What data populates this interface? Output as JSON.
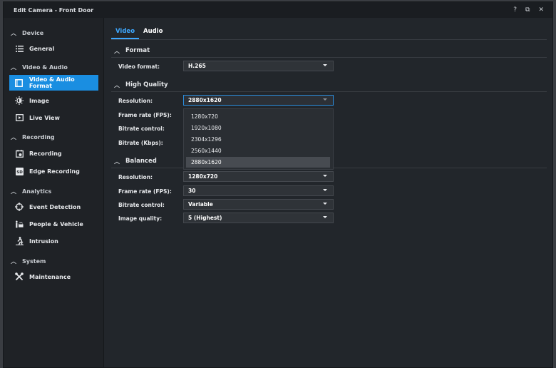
{
  "window": {
    "title": "Edit Camera - Front Door",
    "help": "?",
    "restore": "⧉",
    "close": "✕"
  },
  "sidebar": {
    "sections": [
      {
        "label": "Device"
      },
      {
        "label": "Video & Audio"
      },
      {
        "label": "Recording"
      },
      {
        "label": "Analytics"
      },
      {
        "label": "System"
      }
    ],
    "items": [
      {
        "label": "General",
        "icon": "list-icon"
      },
      {
        "label": "Video & Audio Format",
        "icon": "video-format-icon"
      },
      {
        "label": "Image",
        "icon": "brightness-icon"
      },
      {
        "label": "Live View",
        "icon": "live-view-icon"
      },
      {
        "label": "Recording",
        "icon": "recording-icon"
      },
      {
        "label": "Edge Recording",
        "icon": "sd-card-icon"
      },
      {
        "label": "Event Detection",
        "icon": "crosshair-icon"
      },
      {
        "label": "People & Vehicle",
        "icon": "people-vehicle-icon"
      },
      {
        "label": "Intrusion",
        "icon": "intrusion-icon"
      },
      {
        "label": "Maintenance",
        "icon": "tools-icon"
      }
    ],
    "active_item": "Video & Audio Format",
    "active_color": "#1a8ee1"
  },
  "tabs": [
    {
      "label": "Video",
      "active": true
    },
    {
      "label": "Audio",
      "active": false
    }
  ],
  "format": {
    "group_label": "Format",
    "video_format_label": "Video format:",
    "video_format_value": "H.265"
  },
  "high_quality": {
    "group_label": "High Quality",
    "resolution_label": "Resolution:",
    "resolution_value": "2880x1620",
    "frame_rate_label": "Frame rate (FPS):",
    "bitrate_control_label": "Bitrate control:",
    "bitrate_label": "Bitrate (Kbps):"
  },
  "resolution_dropdown": {
    "options": [
      "1280x720",
      "1920x1080",
      "2304x1296",
      "2560x1440",
      "2880x1620"
    ],
    "selected": "2880x1620"
  },
  "balanced": {
    "group_label": "Balanced",
    "resolution_label": "Resolution:",
    "resolution_value": "1280x720",
    "frame_rate_label": "Frame rate (FPS):",
    "frame_rate_value": "30",
    "bitrate_control_label": "Bitrate control:",
    "bitrate_control_value": "Variable",
    "image_quality_label": "Image quality:",
    "image_quality_value": "5 (Highest)"
  }
}
